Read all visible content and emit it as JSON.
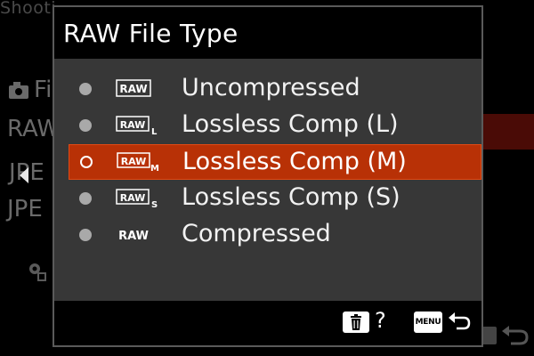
{
  "background": {
    "header": "Shooti",
    "items": [
      "Fi",
      "RAW",
      "JPE",
      "JPE"
    ]
  },
  "dialog": {
    "title": "RAW File Type",
    "options": [
      {
        "label": "Uncompressed",
        "icon_badge": "RAW",
        "icon_sub": "",
        "icon": "raw-boxed-icon",
        "selected": false
      },
      {
        "label": "Lossless Comp (L)",
        "icon_badge": "RAW",
        "icon_sub": "L",
        "icon": "raw-lossless-l-icon",
        "selected": false
      },
      {
        "label": "Lossless Comp (M)",
        "icon_badge": "RAW",
        "icon_sub": "M",
        "icon": "raw-lossless-m-icon",
        "selected": true
      },
      {
        "label": "Lossless Comp (S)",
        "icon_badge": "RAW",
        "icon_sub": "S",
        "icon": "raw-lossless-s-icon",
        "selected": false
      },
      {
        "label": "Compressed",
        "icon_badge": "RAW",
        "icon_sub": "",
        "icon": "raw-plain-icon",
        "selected": false
      }
    ],
    "footer": {
      "help": "?",
      "menu_key": "MENU"
    }
  },
  "colors": {
    "selection": "#b83106",
    "dialog_bg": "#373737",
    "text": "#ffffff"
  }
}
